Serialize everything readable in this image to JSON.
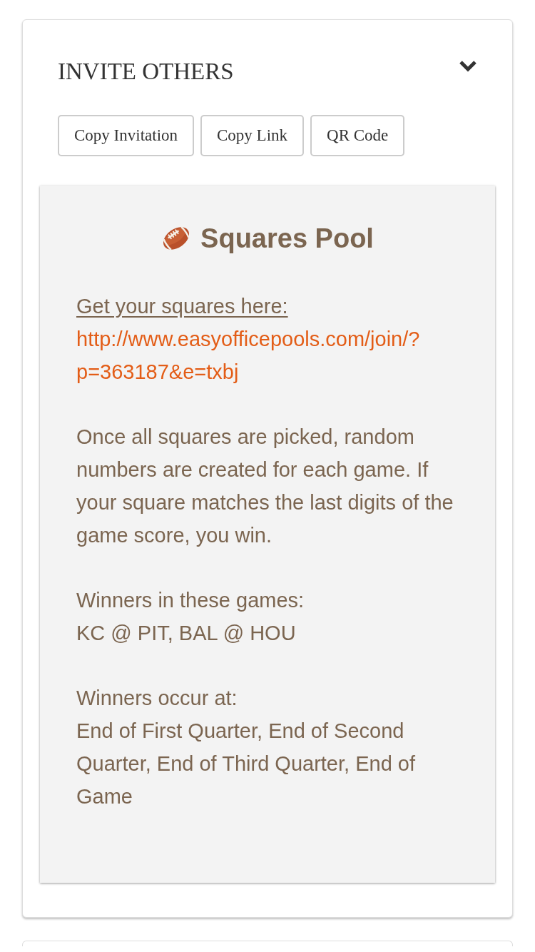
{
  "section": {
    "title": "INVITE OTHERS",
    "expanded": true
  },
  "buttons": [
    {
      "label": "Copy Invitation"
    },
    {
      "label": "Copy Link"
    },
    {
      "label": "QR Code"
    }
  ],
  "invitation": {
    "title": "Squares Pool",
    "intro": "Get your squares here:",
    "link": "http://www.easyofficepools.com/join/?p=363187&e=txbj",
    "description": "Once all squares are picked, random numbers are created for each game. If your square matches the last digits of the game score, you win.",
    "details": [
      {
        "label": "Winners in these games:",
        "value": "KC @ PIT, BAL @ HOU"
      },
      {
        "label": "Winners occur at:",
        "value": "End of First Quarter, End of Second Quarter, End of Third Quarter, End of Game"
      }
    ]
  }
}
